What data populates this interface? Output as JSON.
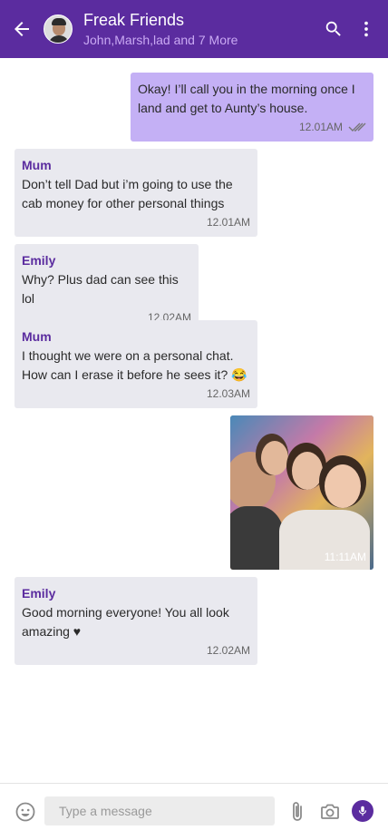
{
  "header": {
    "title": "Freak Friends",
    "subtitle": "John,Marsh,lad and 7 More",
    "back_icon": "arrow-left-icon",
    "search_icon": "search-icon",
    "menu_icon": "more-vertical-icon",
    "color": "#5b2c9f"
  },
  "messages": [
    {
      "type": "outgoing",
      "text": "Okay! I’ll call you in the morning once I land and get to Aunty’s house.",
      "time": "12.01AM",
      "status": "read"
    },
    {
      "type": "incoming",
      "sender": "Mum",
      "text": "Don’t tell Dad but i’m going to use the cab money for other personal things",
      "time": "12.01AM"
    },
    {
      "type": "incoming",
      "sender": "Emily",
      "text": "Why? Plus dad can see this lol",
      "time": "12.02AM"
    },
    {
      "type": "incoming",
      "sender": "Mum",
      "text": "I thought we were on a personal chat. How can I erase it before he sees it? 😂",
      "time": "12.03AM"
    },
    {
      "type": "outgoing-image",
      "time": "11:11AM"
    },
    {
      "type": "incoming",
      "sender": "Emily",
      "text": "Good morning everyone! You all look amazing ♥",
      "time": "12.02AM"
    }
  ],
  "composer": {
    "placeholder": "Type a message",
    "value": "",
    "emoji_icon": "emoji-icon",
    "attach_icon": "paperclip-icon",
    "camera_icon": "camera-icon",
    "mic_icon": "microphone-icon"
  },
  "colors": {
    "accent": "#5b2c9f",
    "outgoing_bubble": "#c4b0f5",
    "incoming_bubble": "#e9e9ef"
  }
}
